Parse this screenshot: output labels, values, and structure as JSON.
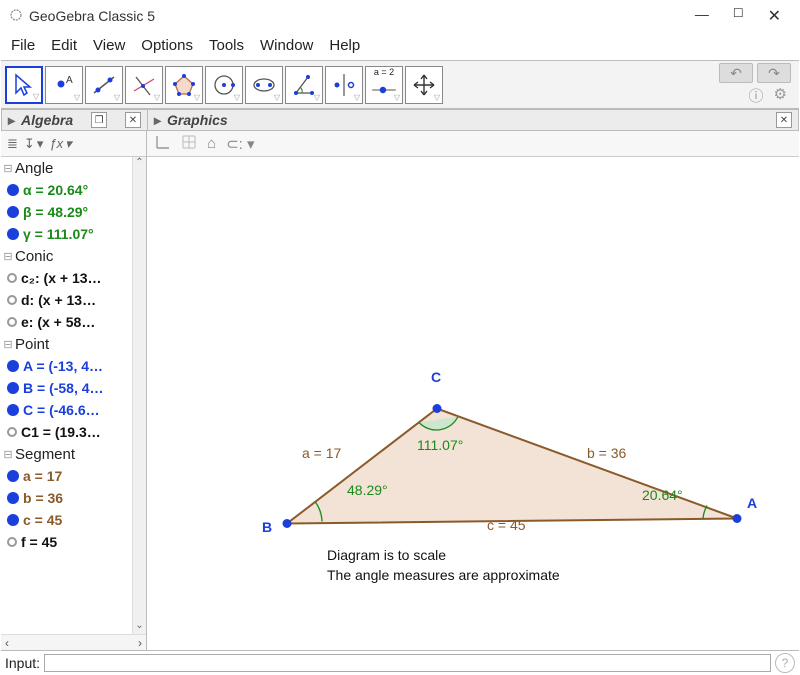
{
  "window": {
    "title": "GeoGebra Classic 5"
  },
  "menu": {
    "file": "File",
    "edit": "Edit",
    "view": "View",
    "options": "Options",
    "tools": "Tools",
    "window": "Window",
    "help": "Help"
  },
  "tooltext": {
    "a2": "a = 2"
  },
  "panels": {
    "algebra": "Algebra",
    "graphics": "Graphics"
  },
  "algebra_toolbar": {
    "sort_icon": "↧",
    "fx": "ƒx"
  },
  "categories": {
    "angle": "Angle",
    "conic": "Conic",
    "point": "Point",
    "segment": "Segment"
  },
  "items": {
    "alpha": "α = 20.64°",
    "beta": "β = 48.29°",
    "gamma": "γ = 111.07°",
    "c2": "c₂: (x + 13…",
    "d": "d: (x + 13…",
    "e": "e: (x + 58…",
    "A": "A = (-13, 4…",
    "B": "B = (-58, 4…",
    "C": "C = (-46.6…",
    "C1": "C1 = (19.3…",
    "a": "a = 17",
    "b": "b = 36",
    "c": "c = 45",
    "f": "f = 45"
  },
  "graphics_toolbar": {
    "home": "⌂",
    "magnet": "⊂:"
  },
  "diagram": {
    "ptA": "A",
    "ptB": "B",
    "ptC": "C",
    "sideA": "a = 17",
    "sideB": "b = 36",
    "sideC": "c = 45",
    "angA": "20.64°",
    "angB": "48.29°",
    "angC": "111.07°",
    "note1": "Diagram is to scale",
    "note2": "The angle measures are approximate"
  },
  "input": {
    "label": "Input:",
    "value": ""
  },
  "chart_data": {
    "type": "diagram",
    "description": "Triangle ABC with labeled sides and interior angles",
    "points": {
      "A": [
        -13,
        4
      ],
      "B": [
        -58,
        4
      ],
      "C": [
        -46.6,
        null
      ]
    },
    "sides": {
      "a": 17,
      "b": 36,
      "c": 45
    },
    "angles_deg": {
      "A": 20.64,
      "B": 48.29,
      "C": 111.07
    },
    "notes": [
      "Diagram is to scale",
      "The angle measures are approximate"
    ]
  }
}
